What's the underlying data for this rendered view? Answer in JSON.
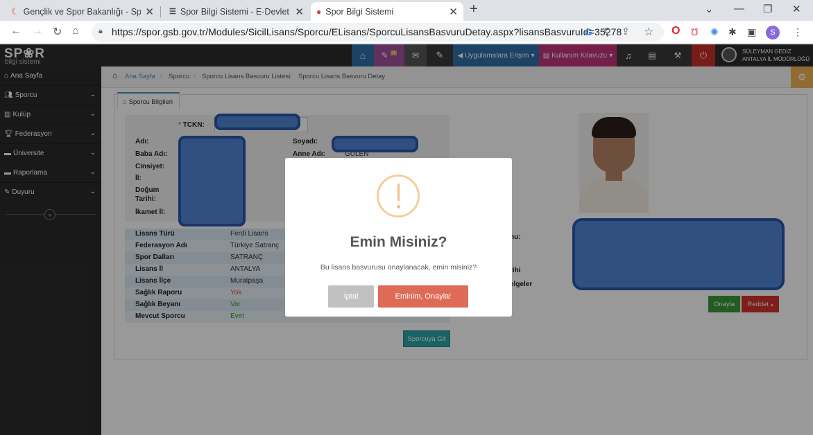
{
  "browser": {
    "tabs": [
      {
        "title": "Gençlik ve Spor Bakanlığı - Spor",
        "icon": "ministry-logo-icon"
      },
      {
        "title": "Spor Bilgi Sistemi - E-Devlet Port",
        "icon": "edevlet-icon"
      },
      {
        "title": "Spor Bilgi Sistemi",
        "icon": "spor-logo-icon"
      }
    ],
    "new_tab": "+",
    "url": "https://spor.gsb.gov.tr/Modules/SicilLisans/Sporcu/ELisans/SporcuLisansBasvuruDetay.aspx?lisansBasvuruId=35278",
    "profile_initial": "S"
  },
  "header": {
    "logo_main": "SP❀R",
    "logo_sub": "bilgi sistemi",
    "badge_count": "0",
    "apps_menu": "Uygulamalara Erişim",
    "guide_menu": "Kullanım Kılavuzu",
    "user_name": "SÜLEYMAN GEDİZ",
    "user_org": "ANTALYA İL MÜDÜRLÜĞÜ"
  },
  "sidebar": {
    "items": [
      {
        "label": "Ana Sayfa",
        "icon": "home-icon",
        "chevron": false
      },
      {
        "label": "Sporcu",
        "icon": "users-icon",
        "chevron": true
      },
      {
        "label": "Kulüp",
        "icon": "chart-icon",
        "chevron": true
      },
      {
        "label": "Federasyon",
        "icon": "trophy-icon",
        "chevron": true
      },
      {
        "label": "Üniversite",
        "icon": "card-icon",
        "chevron": true
      },
      {
        "label": "Raporlama",
        "icon": "card-icon",
        "chevron": true
      },
      {
        "label": "Duyuru",
        "icon": "edit-icon",
        "chevron": true
      }
    ],
    "collapse": "«"
  },
  "breadcrumb": [
    "Ana Sayfa",
    "Sporcu",
    "Sporcu Lisans Basvuru Listesi",
    "Sporcu Lisans Basvuru Detay"
  ],
  "tab_label": "Sporcu Bilgileri",
  "personal": {
    "tckn_label": "TCKN:",
    "tckn_required": "*",
    "adi": "Adı:",
    "soyadi": "Soyadı:",
    "baba_adi": "Baba Adı:",
    "anne_adi": "Anne Adı:",
    "anne_adi_value": "GÜLEN",
    "cinsiyet": "Cinsiyet:",
    "il": "İl:",
    "dogum1": "Doğum",
    "dogum2": "Tarihi:",
    "ikamet": "İkamet İl:"
  },
  "license": {
    "rows": [
      {
        "label": "Lisans Türü",
        "value": "Ferdi Lisans",
        "color": "#333"
      },
      {
        "label": "Federasyon Adı",
        "value": "Türkiye Satranç",
        "color": "#333"
      },
      {
        "label": "Spor Dalları",
        "value": "SATRANÇ",
        "color": "#333"
      },
      {
        "label": "Lisans İl",
        "value": "ANTALYA",
        "color": "#333"
      },
      {
        "label": "Lisans İlçe",
        "value": "Muratpaşa",
        "color": "#333"
      },
      {
        "label": "Sağlık Raporu",
        "value": "Yok",
        "color": "#d15b47"
      },
      {
        "label": "Sağlık Beyanı",
        "value": "Var",
        "color": "#3a9a3a"
      },
      {
        "label": "Mevcut Sporcu",
        "value": "Evet",
        "color": "#3a9a3a"
      }
    ],
    "go_button": "Sporcuya Git"
  },
  "right_labels": {
    "colon": ":",
    "onu": "nu:",
    "rihi": "rihi",
    "belgeler": "elgeler"
  },
  "actions": {
    "approve": "Onayla",
    "reject": "Reddet"
  },
  "modal": {
    "title": "Emin Misiniz?",
    "text": "Bu lisans basvurusu onaylanacak, emin misiniz?",
    "cancel": "İptal",
    "confirm": "Eminim, Onayla!"
  }
}
